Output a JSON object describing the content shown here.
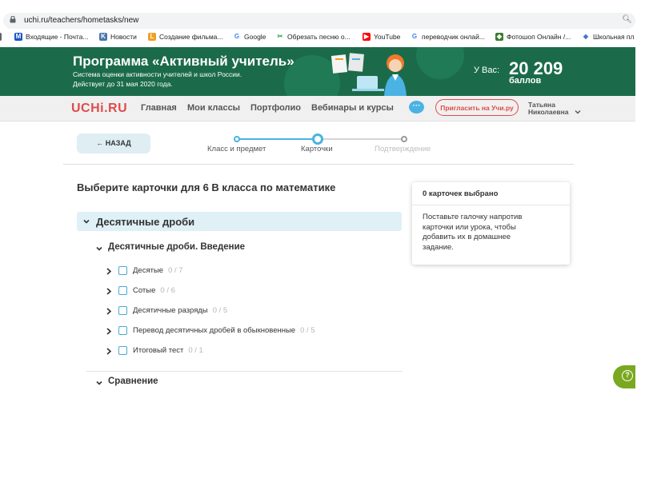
{
  "browser": {
    "url": "uchi.ru/teachers/hometasks/new",
    "bookmarks": [
      {
        "label": "Входящие - Почта...",
        "icon": "mail-icon",
        "color": "#1a56c9"
      },
      {
        "label": "Новости",
        "icon": "vk-icon",
        "color": "#4a76a8"
      },
      {
        "label": "Создание фильма...",
        "icon": "film-icon",
        "color": "#f0a020"
      },
      {
        "label": "Google",
        "icon": "google-icon",
        "color": "#4285f4"
      },
      {
        "label": "Обрезать песню о...",
        "icon": "scissors-icon",
        "color": "#2c9c4a"
      },
      {
        "label": "YouTube",
        "icon": "youtube-icon",
        "color": "#ff0000"
      },
      {
        "label": "переводчик онлай...",
        "icon": "google-icon",
        "color": "#4285f4"
      },
      {
        "label": "Фотошоп Онлайн /...",
        "icon": "photoshop-icon",
        "color": "#3b7d2e"
      },
      {
        "label": "Школьная пл",
        "icon": "school-icon",
        "color": "#3a6bd6"
      }
    ]
  },
  "banner": {
    "title": "Программа «Активный учитель»",
    "subtitle_line1": "Система оценки активности учителей и школ России.",
    "subtitle_line2": "Действует до 31 мая 2020 года.",
    "balance_label": "У Вас:",
    "points": "20 209",
    "points_unit": "баллов"
  },
  "nav": {
    "logo": "UCHi.RU",
    "items": [
      "Главная",
      "Мои классы",
      "Портфолио",
      "Вебинары и курсы"
    ],
    "invite_button": "Пригласить на Учи.ру",
    "user_first": "Татьяна",
    "user_last": "Николаевна"
  },
  "steps": {
    "back_label": "← НАЗАД",
    "items": [
      {
        "label": "Класс и предмет",
        "state": "done"
      },
      {
        "label": "Карточки",
        "state": "current"
      },
      {
        "label": "Подтверждение",
        "state": "pending"
      }
    ]
  },
  "main": {
    "heading": "Выберите карточки для 6 В класса по математике",
    "section_title": "Десятичные дроби",
    "subsection_title": "Десятичные дроби. Введение",
    "lessons": [
      {
        "label": "Десятые",
        "count": "0 / 7"
      },
      {
        "label": "Сотые",
        "count": "0 / 6"
      },
      {
        "label": "Десятичные разряды",
        "count": "0 / 5"
      },
      {
        "label": "Перевод десятичных дробей в обыкновенные",
        "count": "0 / 5"
      },
      {
        "label": "Итоговый тест",
        "count": "0 / 1"
      }
    ],
    "next_subsection_title": "Сравнение"
  },
  "side_card": {
    "header": "0 карточек выбрано",
    "body": "Поставьте галочку напротив карточки или урока, чтобы добавить их в домашнее задание."
  },
  "colors": {
    "banner_green": "#1b6b4a",
    "brand_red": "#e04b4b",
    "accent_blue": "#4aa9d6",
    "help_green": "#7aa820"
  }
}
